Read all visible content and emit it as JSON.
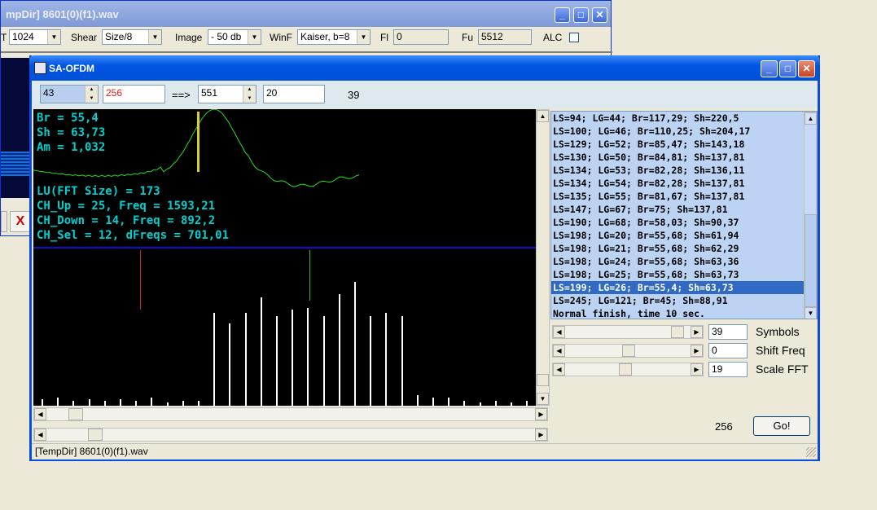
{
  "back_window": {
    "title": "mpDir] 8601(0)(f1).wav",
    "toolbar": {
      "fft_label": "T",
      "fft_value": "1024",
      "shear_label": "Shear",
      "shear_value": "Size/8",
      "image_label": "Image",
      "image_value": "- 50 db",
      "winf_label": "WinF",
      "winf_value": "Kaiser, b=8",
      "fl_label": "Fl",
      "fl_value": "0",
      "fu_label": "Fu",
      "fu_value": "5512",
      "alc_label": "ALC"
    },
    "close_glyph": "X"
  },
  "window": {
    "title": "SA-OFDM",
    "status": "[TempDir] 8601(0)(f1).wav"
  },
  "params": {
    "a": "43",
    "b": "256",
    "arrow": "==>",
    "c": "551",
    "d": "20",
    "e": "39"
  },
  "plot": {
    "br": "Br = 55,4",
    "sh": "Sh = 63,73",
    "am": "Am = 1,032",
    "lu": "LU(FFT Size) = 173",
    "ch_up": "CH_Up = 25, Freq = 1593,21",
    "ch_down": "CH_Down = 14, Freq = 892,2",
    "ch_sel": "CH_Sel = 12, dFreqs = 701,01",
    "colors": {
      "text": "#00d0d0",
      "curve": "#22dd22",
      "marker": "#d8d020",
      "separator": "#1010d0",
      "red_line": "#d02020",
      "green_line": "#20c020"
    },
    "spectrum": [
      0.04,
      0.05,
      0.03,
      0.04,
      0.03,
      0.04,
      0.03,
      0.05,
      0.02,
      0.03,
      0.03,
      0.6,
      0.53,
      0.6,
      0.7,
      0.58,
      0.62,
      0.63,
      0.58,
      0.72,
      0.8,
      0.58,
      0.6,
      0.58,
      0.07,
      0.05,
      0.05,
      0.03,
      0.02,
      0.03,
      0.02,
      0.03,
      0.02,
      0.03,
      0.02,
      0.03,
      0.02,
      0.02,
      0.02,
      0.02
    ]
  },
  "results": [
    "LS=94; LG=44; Br=117,29; Sh=220,5",
    "LS=100; LG=46; Br=110,25; Sh=204,17",
    "LS=129; LG=52; Br=85,47; Sh=143,18",
    "LS=130; LG=50; Br=84,81; Sh=137,81",
    "LS=134; LG=53; Br=82,28; Sh=136,11",
    "LS=134; LG=54; Br=82,28; Sh=137,81",
    "LS=135; LG=55; Br=81,67; Sh=137,81",
    "LS=147; LG=67; Br=75; Sh=137,81",
    "LS=190; LG=68; Br=58,03; Sh=90,37",
    "LS=198; LG=20; Br=55,68; Sh=61,94",
    "LS=198; LG=21; Br=55,68; Sh=62,29",
    "LS=198; LG=24; Br=55,68; Sh=63,36",
    "LS=198; LG=25; Br=55,68; Sh=63,73",
    "LS=199; LG=26; Br=55,4; Sh=63,73",
    "LS=245; LG=121; Br=45; Sh=88,91",
    "Normal finish, time 10 sec."
  ],
  "results_selected_index": 13,
  "sliders": [
    {
      "value": "39",
      "label": "Symbols",
      "level": 0.93
    },
    {
      "value": "0",
      "label": "Shift Freq",
      "level": 0.5
    },
    {
      "value": "19",
      "label": "Scale FFT",
      "level": 0.47
    }
  ],
  "footer": {
    "count": "256",
    "go_label": "Go!"
  }
}
